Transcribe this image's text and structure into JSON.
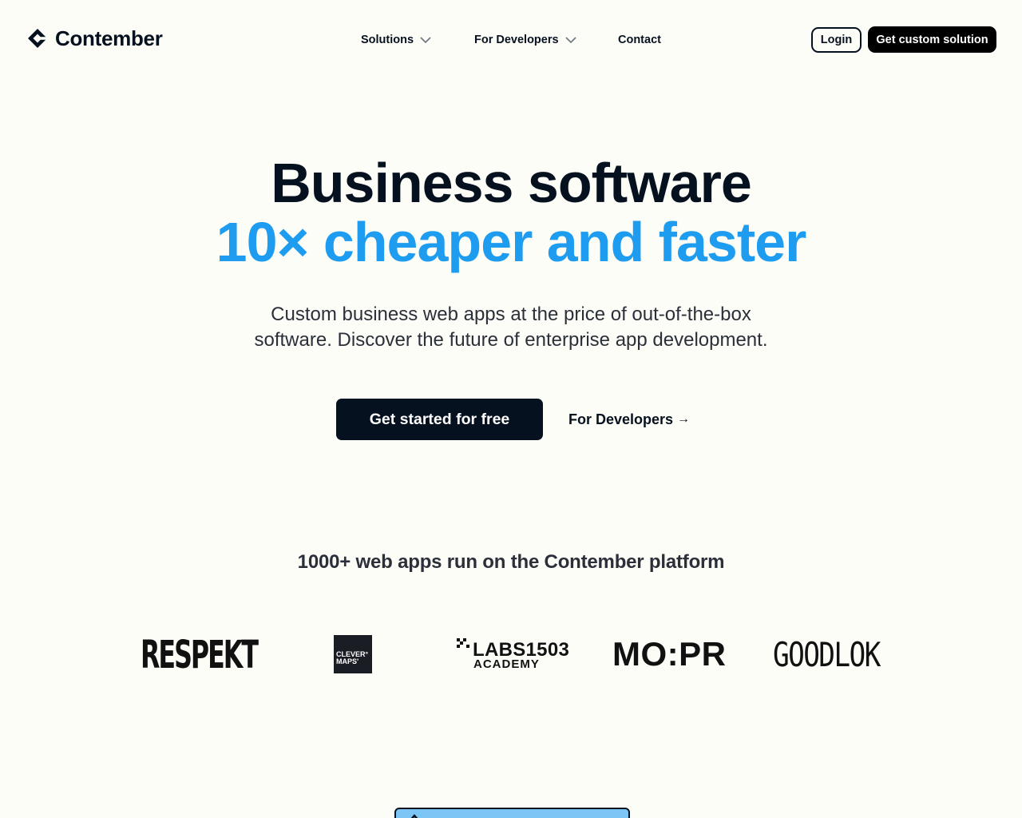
{
  "brand": {
    "name": "Contember"
  },
  "nav": {
    "items": [
      {
        "label": "Solutions",
        "has_dropdown": true
      },
      {
        "label": "For Developers",
        "has_dropdown": true
      },
      {
        "label": "Contact",
        "has_dropdown": false
      }
    ],
    "login_label": "Login",
    "cta_label": "Get custom solution"
  },
  "hero": {
    "title_line1": "Business software",
    "title_line2": "10× cheaper and faster",
    "subtitle": "Custom business web apps at the price of out-of-the-box software. Discover the future of enterprise app development.",
    "primary_cta": "Get started for free",
    "secondary_cta": "For Developers",
    "secondary_arrow": "→"
  },
  "trust": {
    "heading": "1000+ web apps run on the Contember platform",
    "logos": [
      {
        "name": "respekt-logo",
        "text": "RESPEKT"
      },
      {
        "name": "clevermaps-logo",
        "line1": "CLEVER°",
        "line2": "MAPS'"
      },
      {
        "name": "labs1503-logo",
        "line1": "LABS1503",
        "line2": "ACADEMY"
      },
      {
        "name": "mopr-logo",
        "text": "MO:PR"
      },
      {
        "name": "goodlok-logo",
        "text": "GOODLOK"
      }
    ]
  },
  "colors": {
    "background": "#fdfdf8",
    "text_dark": "#06111f",
    "accent_blue": "#1e9cf0",
    "banner_blue": "#7cc6f5"
  }
}
